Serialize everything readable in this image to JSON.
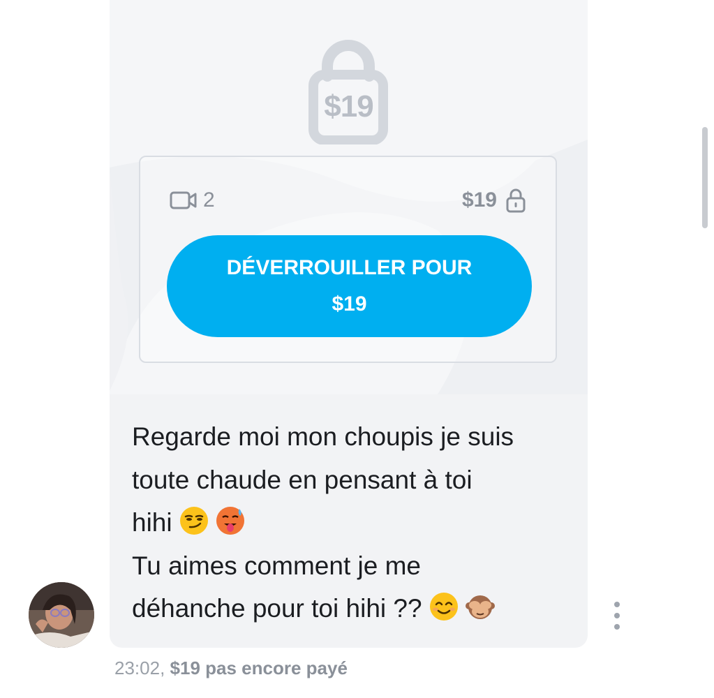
{
  "post": {
    "locked_price": "$19",
    "media": {
      "video_icon": "video-camera-icon",
      "video_count": "2",
      "price": "$19",
      "price_lock_icon": "padlock-icon"
    },
    "unlock_button": {
      "line1": "DÉVERROUILLER POUR",
      "line2": "$19"
    },
    "message": {
      "line1": "Regarde moi mon choupis je suis",
      "line2": "toute chaude en pensant à toi",
      "line3": "hihi",
      "line4": "Tu aimes comment je me",
      "line5": "déhanche pour toi hihi ??"
    },
    "meta": {
      "time": "23:02,",
      "status": "$19 pas encore payé"
    }
  },
  "colors": {
    "accent": "#00aff0",
    "bubble": "#f2f3f5",
    "muted": "#8a9099"
  }
}
